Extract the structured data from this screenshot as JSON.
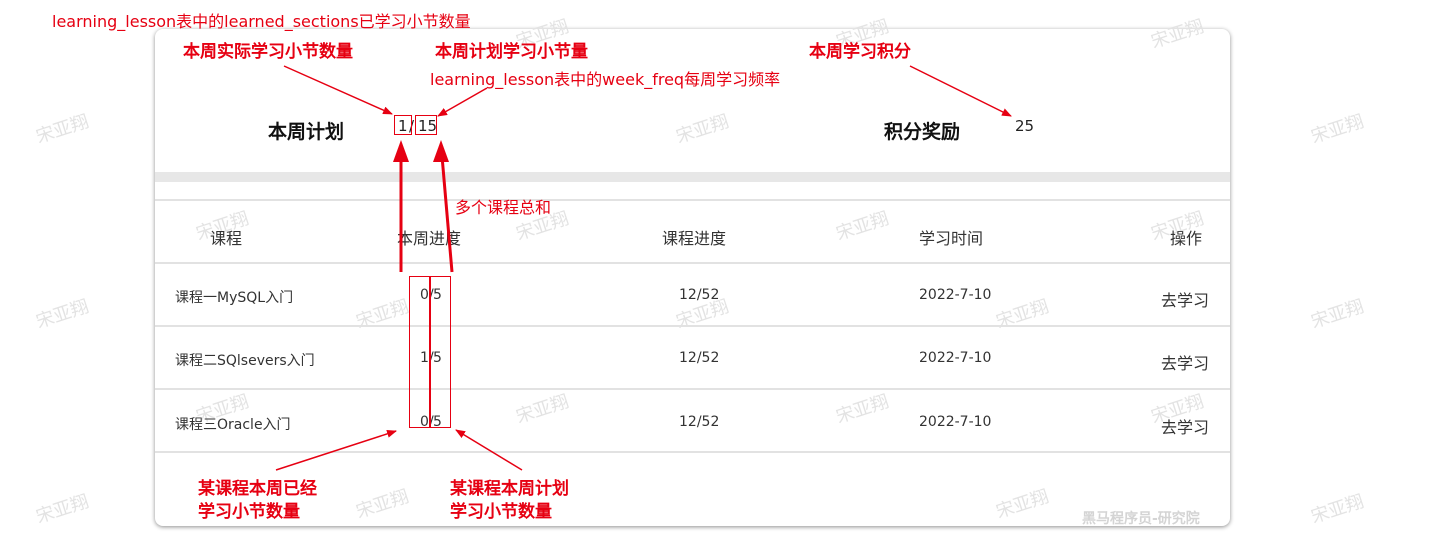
{
  "header": {
    "source_note": "learning_lesson表中的learned_sections已学习小节数量",
    "weekly_plan_label": "本周计划",
    "weekly_learned": "1",
    "weekly_planned": "15",
    "points_label": "积分奖励",
    "points_value": "25"
  },
  "annotations": {
    "actual_label": "本周实际学习小节数量",
    "plan_label": "本周计划学习小节量",
    "week_freq_note": "learning_lesson表中的week_freq每周学习频率",
    "points_label": "本周学习积分",
    "sum_label": "多个课程总和",
    "course_learned_label": "某课程本周已经\n学习小节数量",
    "course_plan_label": "某课程本周计划\n学习小节数量"
  },
  "table": {
    "headers": [
      "课程",
      "本周进度",
      "课程进度",
      "学习时间",
      "操作"
    ],
    "rows": [
      {
        "course": "课程一MySQL入门",
        "learned": "0",
        "planned": "5",
        "progress": "12/52",
        "date": "2022-7-10",
        "action": "去学习"
      },
      {
        "course": "课程二SQlsevers入门",
        "learned": "1",
        "planned": "5",
        "progress": "12/52",
        "date": "2022-7-10",
        "action": "去学习"
      },
      {
        "course": "课程三Oracle入门",
        "learned": "0",
        "planned": "5",
        "progress": "12/52",
        "date": "2022-7-10",
        "action": "去学习"
      }
    ]
  },
  "watermark": {
    "text": "宋亚翔",
    "footer": "黑马程序员-研究院"
  },
  "colors": {
    "annotation": "#e60012",
    "separator": "#e7e7e7",
    "text": "#333333"
  }
}
